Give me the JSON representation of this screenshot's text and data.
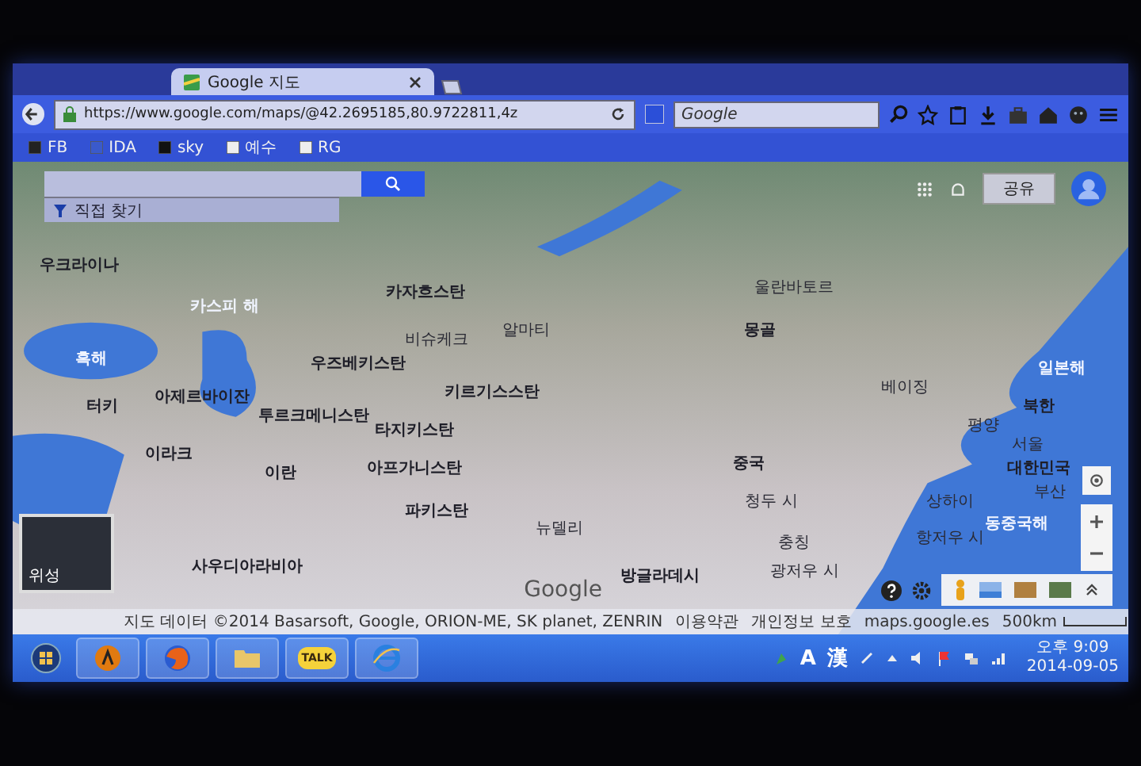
{
  "browser": {
    "tabs": [
      {
        "title": "Google 지도",
        "selected": true
      }
    ],
    "url": "https://www.google.com/maps/@42.2695185,80.9722811,4z",
    "search_placeholder": "Google",
    "bookmarks": [
      {
        "label": "FB"
      },
      {
        "label": "IDA"
      },
      {
        "label": "sky"
      },
      {
        "label": "예수"
      },
      {
        "label": "RG"
      }
    ]
  },
  "map": {
    "explore_link": "직접 찾기",
    "share_button": "공유",
    "labels": [
      {
        "text": "우크라이나",
        "kind": "country"
      },
      {
        "text": "흑해",
        "kind": "sea"
      },
      {
        "text": "터키",
        "kind": "country"
      },
      {
        "text": "카스피 해",
        "kind": "sea"
      },
      {
        "text": "아제르바이잔",
        "kind": "country"
      },
      {
        "text": "이라크",
        "kind": "country"
      },
      {
        "text": "이란",
        "kind": "country"
      },
      {
        "text": "사우디아라비아",
        "kind": "country"
      },
      {
        "text": "카자흐스탄",
        "kind": "country"
      },
      {
        "text": "우즈베키스탄",
        "kind": "country"
      },
      {
        "text": "투르크메니스탄",
        "kind": "country"
      },
      {
        "text": "키르기스스탄",
        "kind": "country"
      },
      {
        "text": "비슈케크",
        "kind": "city"
      },
      {
        "text": "알마티",
        "kind": "city"
      },
      {
        "text": "타지키스탄",
        "kind": "country"
      },
      {
        "text": "아프가니스탄",
        "kind": "country"
      },
      {
        "text": "파키스탄",
        "kind": "country"
      },
      {
        "text": "뉴델리",
        "kind": "city"
      },
      {
        "text": "방글라데시",
        "kind": "country"
      },
      {
        "text": "울란바토르",
        "kind": "city"
      },
      {
        "text": "몽골",
        "kind": "country"
      },
      {
        "text": "베이징",
        "kind": "city"
      },
      {
        "text": "중국",
        "kind": "country"
      },
      {
        "text": "청두 시",
        "kind": "city"
      },
      {
        "text": "충칭",
        "kind": "city"
      },
      {
        "text": "상하이",
        "kind": "city"
      },
      {
        "text": "항저우 시",
        "kind": "city"
      },
      {
        "text": "광저우 시",
        "kind": "city"
      },
      {
        "text": "일본해",
        "kind": "sea"
      },
      {
        "text": "북한",
        "kind": "country"
      },
      {
        "text": "평양",
        "kind": "city"
      },
      {
        "text": "서울",
        "kind": "city"
      },
      {
        "text": "대한민국",
        "kind": "country"
      },
      {
        "text": "부산",
        "kind": "city"
      },
      {
        "text": "동중국해",
        "kind": "sea"
      }
    ],
    "earth_thumbnail": {
      "label": "위성"
    },
    "logo": "Google",
    "footer": [
      "지도 데이터 ©2014 Basarsoft, Google, ORION-ME, SK planet, ZENRIN",
      "이용약관",
      "개인정보 보호",
      "maps.google.es"
    ],
    "scale": "500km"
  },
  "taskbar": {
    "apps": [
      {
        "kind": "start"
      },
      {
        "kind": "app"
      },
      {
        "kind": "firefox"
      },
      {
        "kind": "folder"
      },
      {
        "kind": "talk",
        "label": "TALK"
      },
      {
        "kind": "ie"
      }
    ],
    "ime": [
      "A",
      "漢"
    ],
    "time": "오후 9:09",
    "date": "2014-09-05"
  }
}
